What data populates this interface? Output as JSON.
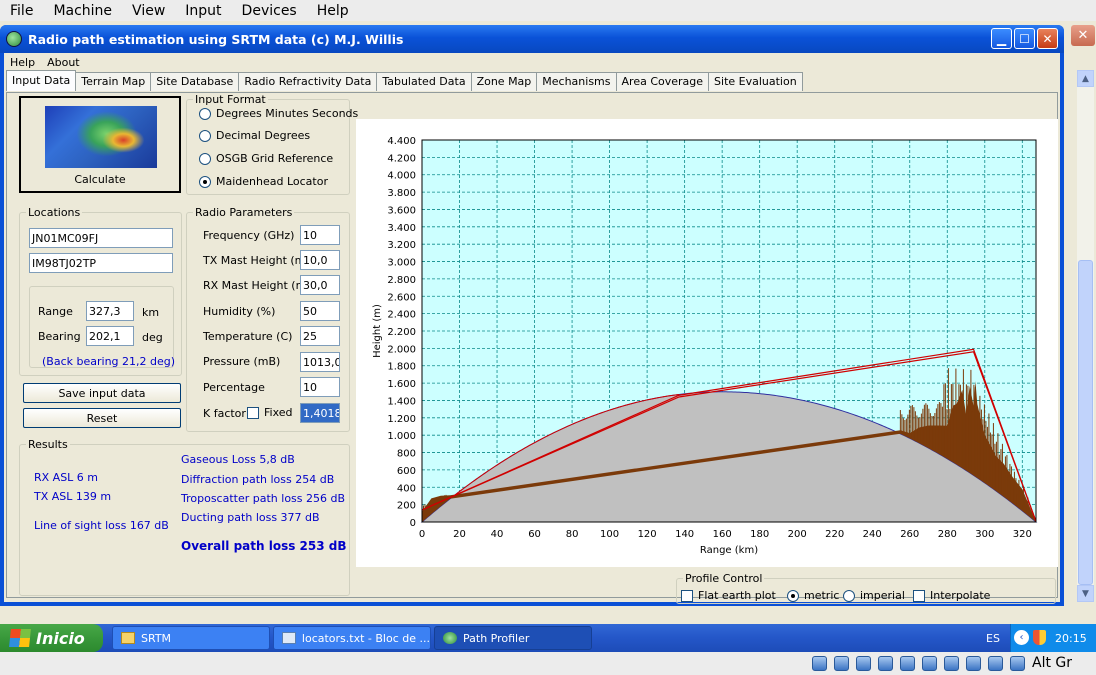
{
  "host_menu": [
    "File",
    "Machine",
    "View",
    "Input",
    "Devices",
    "Help"
  ],
  "window": {
    "title": "Radio path estimation using SRTM data (c) M.J. Willis"
  },
  "app_menu": [
    "Help",
    "About"
  ],
  "tabs": [
    "Input Data",
    "Terrain Map",
    "Site Database",
    "Radio Refractivity Data",
    "Tabulated Data",
    "Zone Map",
    "Mechanisms",
    "Area Coverage",
    "Site Evaluation"
  ],
  "calculate": {
    "label": "Calculate"
  },
  "input_format": {
    "legend": "Input Format",
    "options": [
      "Degrees Minutes Seconds",
      "Decimal Degrees",
      "OSGB Grid Reference",
      "Maidenhead Locator"
    ],
    "selected": "Maidenhead Locator"
  },
  "locations": {
    "legend": "Locations",
    "loc1": "JN01MC09FJ",
    "loc2": "IM98TJ02TP",
    "range_label": "Range",
    "range_value": "327,3",
    "range_unit": "km",
    "bearing_label": "Bearing",
    "bearing_value": "202,1",
    "bearing_unit": "deg",
    "back_bearing": "(Back bearing 21,2 deg)"
  },
  "buttons": {
    "save": "Save input data",
    "reset": "Reset"
  },
  "radio": {
    "legend": "Radio Parameters",
    "freq_label": "Frequency (GHz)",
    "freq": "10",
    "tx_label": "TX Mast Height (m)",
    "tx": "10,0",
    "rx_label": "RX Mast Height (m)",
    "rx": "30,0",
    "hum_label": "Humidity (%)",
    "hum": "50",
    "temp_label": "Temperature (C)",
    "temp": "25",
    "pres_label": "Pressure (mB)",
    "pres": "1013,0",
    "pct_label": "Percentage",
    "pct": "10",
    "k_label": "K factor",
    "fixed_label": "Fixed",
    "k": "1,4018"
  },
  "results": {
    "legend": "Results",
    "rx_asl": "RX ASL 6 m",
    "tx_asl": "TX ASL 139 m",
    "los": "Line of sight loss 167 dB",
    "gaseous": "Gaseous Loss 5,8 dB",
    "diffraction": "Diffraction path loss 254 dB",
    "troposcatter": "Troposcatter path loss 256 dB",
    "ducting": "Ducting path loss 377 dB",
    "overall": "Overall path loss 253 dB"
  },
  "profile_control": {
    "legend": "Profile Control",
    "flat_earth": "Flat earth plot",
    "metric": "metric",
    "imperial": "imperial",
    "interpolate": "Interpolate",
    "unit_selected": "metric"
  },
  "chart_data": {
    "type": "area",
    "xlabel": "Range (km)",
    "ylabel": "Height (m)",
    "xlim": [
      0,
      327.3
    ],
    "ylim": [
      0,
      4400
    ],
    "xticks": [
      "0",
      "20",
      "40",
      "60",
      "80",
      "100",
      "120",
      "140",
      "160",
      "180",
      "200",
      "220",
      "240",
      "260",
      "280",
      "300",
      "320"
    ],
    "yticks": [
      "0",
      "200",
      "400",
      "600",
      "800",
      "1.000",
      "1.200",
      "1.400",
      "1.600",
      "1.800",
      "2.000",
      "2.200",
      "2.400",
      "2.600",
      "2.800",
      "3.000",
      "3.200",
      "3.400",
      "3.600",
      "3.800",
      "4.000",
      "4.200",
      "4.400"
    ],
    "grid": true,
    "earth_bulge": {
      "max_height": 1500,
      "at_range": 160
    },
    "terrain": {
      "x": [
        0,
        5,
        10,
        15,
        255,
        260,
        265,
        270,
        275,
        280,
        283,
        285,
        288,
        290,
        292,
        294,
        295,
        296,
        298,
        300,
        303,
        306,
        310,
        315,
        320,
        325,
        327.3
      ],
      "y_above_bulge": [
        120,
        180,
        120,
        40,
        40,
        60,
        180,
        260,
        320,
        380,
        650,
        700,
        900,
        650,
        1000,
        800,
        1100,
        850,
        700,
        550,
        480,
        400,
        380,
        300,
        250,
        80,
        0
      ]
    },
    "path_lines": [
      {
        "name": "",
        "points": [
          [
            0,
            139
          ],
          [
            137,
            1440
          ],
          [
            294,
            1960
          ],
          [
            327.3,
            6
          ]
        ]
      },
      {
        "name": "",
        "points": [
          [
            0,
            139
          ],
          [
            137,
            1460
          ],
          [
            294,
            1990
          ],
          [
            327.3,
            6
          ]
        ]
      }
    ],
    "colors": {
      "sky": "#ccffff",
      "earth": "#c0c0c0",
      "terrain": "#7b3a0a",
      "path": "#d00000",
      "bulge_edge": "#3030a0"
    }
  },
  "taskbar": {
    "start": "Inicio",
    "tasks": [
      "SRTM",
      "locators.txt - Bloc de ...",
      "Path Profiler"
    ],
    "active_task": "Path Profiler",
    "lang": "ES",
    "time": "20:15"
  },
  "host_status": {
    "text": "Alt Gr"
  },
  "icons": {
    "app": "globe-icon",
    "folder": "folder-icon",
    "notepad": "notepad-icon"
  }
}
